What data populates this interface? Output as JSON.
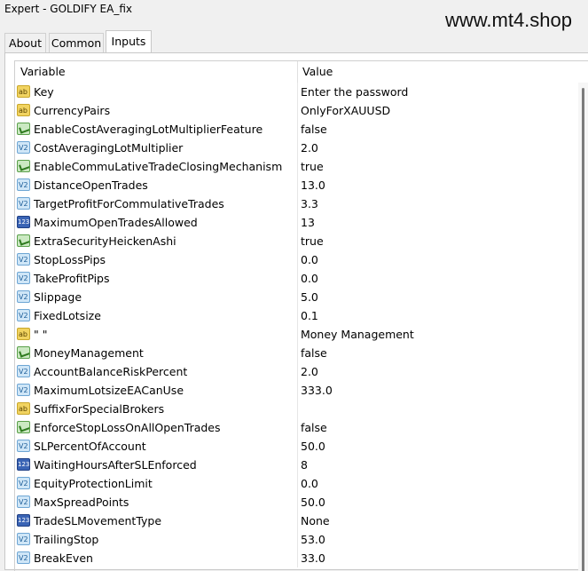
{
  "window": {
    "title": "Expert - GOLDIFY EA_fix",
    "watermark": "www.mt4.shop"
  },
  "tabs": [
    {
      "label": "About",
      "active": false
    },
    {
      "label": "Common",
      "active": false
    },
    {
      "label": "Inputs",
      "active": true
    }
  ],
  "table": {
    "headers": {
      "variable": "Variable",
      "value": "Value"
    },
    "rows": [
      {
        "icon": "ab",
        "name": "Key",
        "value": "Enter the password"
      },
      {
        "icon": "ab",
        "name": "CurrencyPairs",
        "value": " OnlyForXAUUSD"
      },
      {
        "icon": "bool",
        "name": "EnableCostAveragingLotMultiplierFeature",
        "value": "false"
      },
      {
        "icon": "dbl",
        "name": "CostAveragingLotMultiplier",
        "value": "2.0"
      },
      {
        "icon": "bool",
        "name": "EnableCommuLativeTradeClosingMechanism",
        "value": "true"
      },
      {
        "icon": "dbl",
        "name": "DistanceOpenTrades",
        "value": "13.0"
      },
      {
        "icon": "dbl",
        "name": "TargetProfitForCommulativeTrades",
        "value": "3.3"
      },
      {
        "icon": "int",
        "name": "MaximumOpenTradesAllowed",
        "value": "13"
      },
      {
        "icon": "bool",
        "name": "ExtraSecurityHeickenAshi",
        "value": "true"
      },
      {
        "icon": "dbl",
        "name": "StopLossPips",
        "value": "0.0"
      },
      {
        "icon": "dbl",
        "name": "TakeProfitPips",
        "value": "0.0"
      },
      {
        "icon": "dbl",
        "name": "Slippage",
        "value": "5.0"
      },
      {
        "icon": "dbl",
        "name": "FixedLotsize",
        "value": "0.1"
      },
      {
        "icon": "ab",
        "name": "\" \"",
        "value": "Money Management"
      },
      {
        "icon": "bool",
        "name": "MoneyManagement",
        "value": "false"
      },
      {
        "icon": "dbl",
        "name": "AccountBalanceRiskPercent",
        "value": "2.0"
      },
      {
        "icon": "dbl",
        "name": "MaximumLotsizeEACanUse",
        "value": "333.0"
      },
      {
        "icon": "ab",
        "name": "SuffixForSpecialBrokers",
        "value": ""
      },
      {
        "icon": "bool",
        "name": "EnforceStopLossOnAllOpenTrades",
        "value": "false"
      },
      {
        "icon": "dbl",
        "name": "SLPercentOfAccount",
        "value": "50.0"
      },
      {
        "icon": "int",
        "name": "WaitingHoursAfterSLEnforced",
        "value": "8"
      },
      {
        "icon": "dbl",
        "name": "EquityProtectionLimit",
        "value": "0.0"
      },
      {
        "icon": "dbl",
        "name": "MaxSpreadPoints",
        "value": "50.0"
      },
      {
        "icon": "int",
        "name": "TradeSLMovementType",
        "value": "None"
      },
      {
        "icon": "dbl",
        "name": "TrailingStop",
        "value": "53.0"
      },
      {
        "icon": "dbl",
        "name": "BreakEven",
        "value": "33.0"
      }
    ]
  }
}
